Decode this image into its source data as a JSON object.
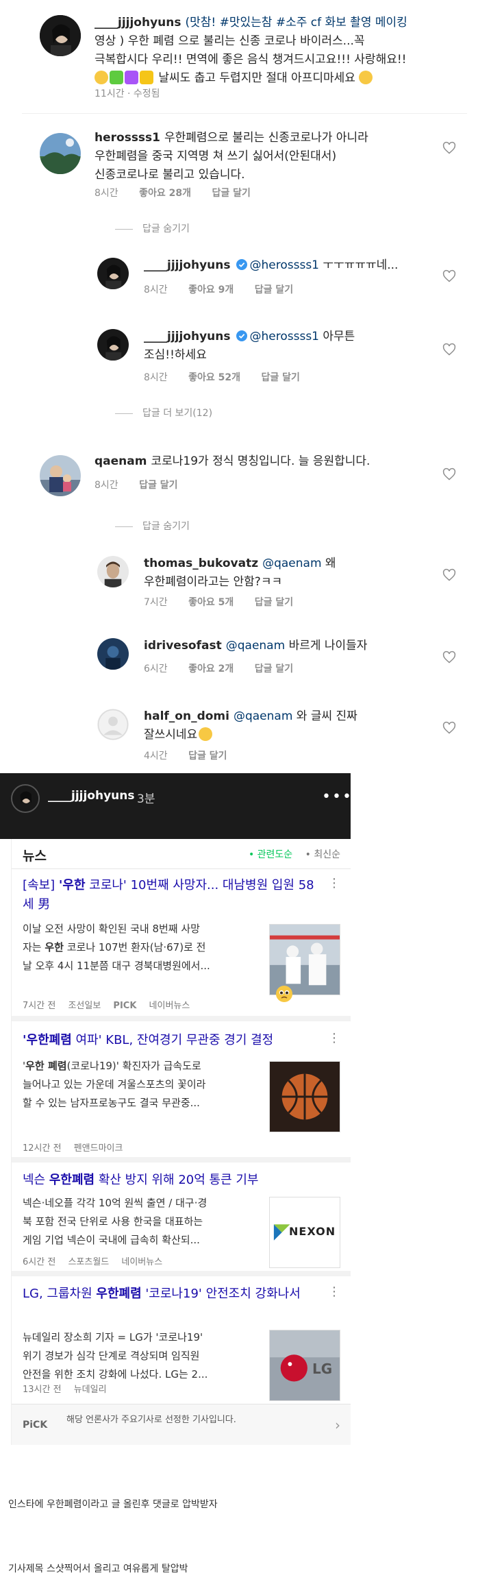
{
  "comments": [
    {
      "user": "____jjjjohyuns",
      "hashtags": [
        "(맛참! ",
        "#맛있는참",
        " ",
        "#소주",
        " cf 화보 촬영 메이킹"
      ],
      "line1_rest": "(맛참! #맛있는참 #소주 cf 화보 촬영 메이킹",
      "line2": "영상 ) 우한 폐렴 으로 불리는 신종 코로나 바이러스...꼭",
      "line3": "극복합시다 우리!! 면역에 좋은 음식 챙겨드시고요!!! 사랑해요!!",
      "line4": "날씨도 춥고 두렵지만 절대 아프디마세요",
      "time": "11시간 · 수정됨"
    },
    {
      "user": "herossss1",
      "line1": "우한폐렴으로 불리는 신종코로나가 아니라",
      "line2": "우한폐렴을 중국 지역명 쳐 쓰기 싫어서(안된대서)",
      "line3": "신종코로나로 불리고 있습니다.",
      "time": "8시간",
      "likes": "좋아요 28개",
      "reply": "답글 달기"
    },
    {
      "toggle": "답글 숨기기"
    },
    {
      "user": "____jjjjohyuns",
      "mention": "@herossss1",
      "text": "ㅜㅜㅠㅠㅠ네...",
      "time": "8시간",
      "likes": "좋아요 9개",
      "reply": "답글 달기"
    },
    {
      "user": "____jjjjohyuns",
      "mention": "@herossss1",
      "text": "아무튼",
      "line2": "조심!!하세요",
      "time": "8시간",
      "likes": "좋아요 52개",
      "reply": "답글 달기"
    },
    {
      "toggle": "답글 더 보기(12)"
    },
    {
      "user": "qaenam",
      "text": "코로나19가 정식 명칭입니다. 늘 응원합니다.",
      "time": "8시간",
      "reply": "답글 달기"
    },
    {
      "toggle": "답글 숨기기"
    },
    {
      "user": "thomas_bukovatz",
      "mention": "@qaenam",
      "text": "왜",
      "line2": "우한폐렴이라고는 안함?ㅋㅋ",
      "time": "7시간",
      "likes": "좋아요 5개",
      "reply": "답글 달기"
    },
    {
      "user": "idrivesofast",
      "mention": "@qaenam",
      "text": "바르게 나이들자",
      "time": "6시간",
      "likes": "좋아요 2개",
      "reply": "답글 달기"
    },
    {
      "user": "half_on_domi",
      "mention": "@qaenam",
      "text": "와 글씨 진짜",
      "line2": "잘쓰시네요",
      "time": "4시간",
      "reply": "답글 달기"
    }
  ],
  "story": {
    "user": "____jjjjohyuns",
    "time": "3분",
    "more": "•••",
    "news_title": "뉴스",
    "sort_active": "관련도순",
    "sort_other": "최신순",
    "articles": [
      {
        "title_pre": "[속보] ",
        "title_kw": "'우한",
        "title_post": " 코로나' 10번째 사망자... 대남병원 입원 58세 男",
        "body_1": "이날 오전 사망이 확인된 국내 8번째 사망",
        "body_2_pre": "자는 ",
        "body_2_kw": "우한",
        "body_2_post": " 코로나 107번 환자(남·67)로 전",
        "body_3": "날 오후 4시 11분쯤 대구 경북대병원에서...",
        "time": "7시간 전",
        "source": "조선일보",
        "pick": "PICK",
        "portal": "네이버뉴스"
      },
      {
        "title_kw": "'우한폐렴",
        "title_post": " 여파' KBL, 잔여경기 무관중 경기 결정",
        "body_1_pre": "'",
        "body_1_kw": "우한 폐렴",
        "body_1_post": "(코로나19)' 확진자가 급속도로",
        "body_2": "늘어나고 있는 가운데 겨울스포츠의 꽃이라",
        "body_3": "할 수 있는 남자프로농구도 결국 무관중...",
        "time": "12시간 전",
        "source": "펜앤드마이크"
      },
      {
        "title_pre": "넥슨 ",
        "title_kw": "우한폐렴",
        "title_post": " 확산 방지 위해 20억 통큰 기부",
        "body_1": "넥슨·네오플 각각 10억 원씩 출연 / 대구·경",
        "body_2": "북 포함 전국 단위로 사용 한국을 대표하는",
        "body_3": "게임 기업 넥슨이 국내에 급속히 확산되...",
        "time": "6시간 전",
        "source": "스포츠월드",
        "portal": "네이버뉴스",
        "thumb_text": "NEXON"
      },
      {
        "title_pre": "LG, 그룹차원 ",
        "title_kw": "우한폐렴",
        "title_post": " '코로나19' 안전조치 강화나서",
        "body_1": "뉴데일리 장소희 기자 = LG가 '코로나19'",
        "body_2": "위기 경보가 심각 단계로 격상되며 임직원",
        "body_3": "안전을 위한 조치 강화에 나섰다. LG는 2...",
        "time": "13시간 전",
        "source": "뉴데일리",
        "thumb_text": "LG"
      }
    ],
    "pick_label": "PiCK",
    "pick_text": "해당 언론사가 주요기사로 선정한 기사입니다."
  },
  "captions": {
    "line1": "인스타에 우한폐렴이라고 글 올린후 댓글로 압박받자",
    "line2": "기사제목 스샷찍어서 올리고 여유롭게 탈압박"
  },
  "colors": {
    "link": "#00376b",
    "muted": "#8e8e8e",
    "news_title": "#1a0dab",
    "naver_green": "#03c75a",
    "verified": "#3897f0"
  }
}
